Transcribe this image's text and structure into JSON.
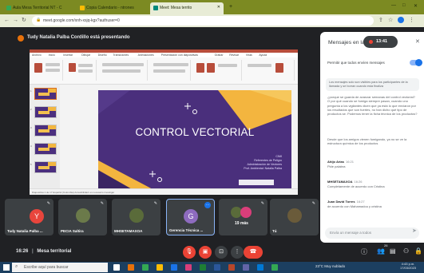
{
  "browser": {
    "tabs": [
      {
        "label": "Aula Mesa Territorial NT - C",
        "color": "#34a853",
        "active": false
      },
      {
        "label": "Copia Calendario - ntrones",
        "color": "#fbbc04",
        "active": false
      },
      {
        "label": "Meet: Mesa territo",
        "color": "#00897b",
        "active": true
      }
    ],
    "new_tab_label": "+",
    "url": "meet.google.com/xnh-xsjq-kgx?authuser=0"
  },
  "meet": {
    "presenter_text": "Tudy Natalia Palba Cordillo está presentando",
    "meeting_time": "16:26",
    "meeting_name": "Mesa territorial",
    "recording_time": "13:41"
  },
  "slide": {
    "title": "CONTROL VECTORIAL",
    "info_lines": [
      "CIMI",
      "Referentes de Peligro",
      "Administración de Vectores",
      "Prof. Ambiental: Natalia Palba"
    ]
  },
  "ppt_status": "Diapositiva 1 de 17   Español (Colombia)   Accesibilidad: es necesario investigar",
  "ribbon_tabs": [
    "Archivo",
    "Inicio",
    "Insertar",
    "Dibujar",
    "Diseño",
    "Transiciones",
    "Animaciones",
    "Presentación con diapositivas",
    "Grabar",
    "Revisar",
    "Vista",
    "Ayuda"
  ],
  "chat": {
    "title": "Mensajes en la llamada",
    "allow_label": "Permitir que todos envíen mensajes",
    "notice": "Los mensajes solo son visibles para los participantes de la llamada y se borran cuando esta finaliza",
    "messages": [
      {
        "sender": "",
        "time": "",
        "text": "¿porque se guarda de avanzar semanas del control vectorial? O por qué cuando se fumiga siempre pasan, cuando uno pregunta a los vigilantes dicen que ya está lo que enviaron por los resultados que son fuertes, no han dicho qué tipo de productos se. Podemos tener la ficha técnica de los productos?"
      },
      {
        "sender": "",
        "time": "",
        "text": "Desde que los amigos vienen fumigando, ya no se ve la estructura química de los productos"
      },
      {
        "sender": "Ahijo Arias",
        "time": "16:21",
        "text": "Pide palabra"
      },
      {
        "sender": "MHSETAMAXOA",
        "time": "16:26",
        "text": "Completamente de acuerdo con Cristina"
      },
      {
        "sender": "Juan David Torres",
        "time": "16:27",
        "text": "de acuerdo con Mahamadou y cristina"
      }
    ],
    "input_placeholder": "Envía un mensaje a todos"
  },
  "participants": [
    {
      "name": "Tudy Natalia Palba ...",
      "initial": "Y",
      "avatar_color": "#e8453c",
      "type": "initial",
      "highlight": false
    },
    {
      "name": "PECIA Saltira",
      "initial": "",
      "avatar_color": "#6b7a4a",
      "type": "photo",
      "highlight": false
    },
    {
      "name": "MHSETAMAXOA",
      "initial": "",
      "avatar_color": "#5a6b3a",
      "type": "photo",
      "highlight": false
    },
    {
      "name": "Gerencia Técnica ...",
      "initial": "G",
      "avatar_color": "#8e6bbf",
      "type": "initial",
      "highlight": true
    },
    {
      "name": "19 más",
      "initial": "",
      "avatar_color": "#5a6b3a",
      "type": "more",
      "highlight": false
    },
    {
      "name": "Tú",
      "initial": "",
      "avatar_color": "#6a5b3a",
      "type": "photo",
      "highlight": false
    }
  ],
  "controls": {
    "mic_icon": "mic-off-icon",
    "cam_icon": "camera-off-icon",
    "hang_color": "#ea4335",
    "participant_count": "26"
  },
  "taskbar": {
    "search_placeholder": "Escribe aquí para buscar",
    "weather": "23°C  Muy nublado",
    "time": "4:43 p.m.",
    "date": "17/03/2023"
  }
}
